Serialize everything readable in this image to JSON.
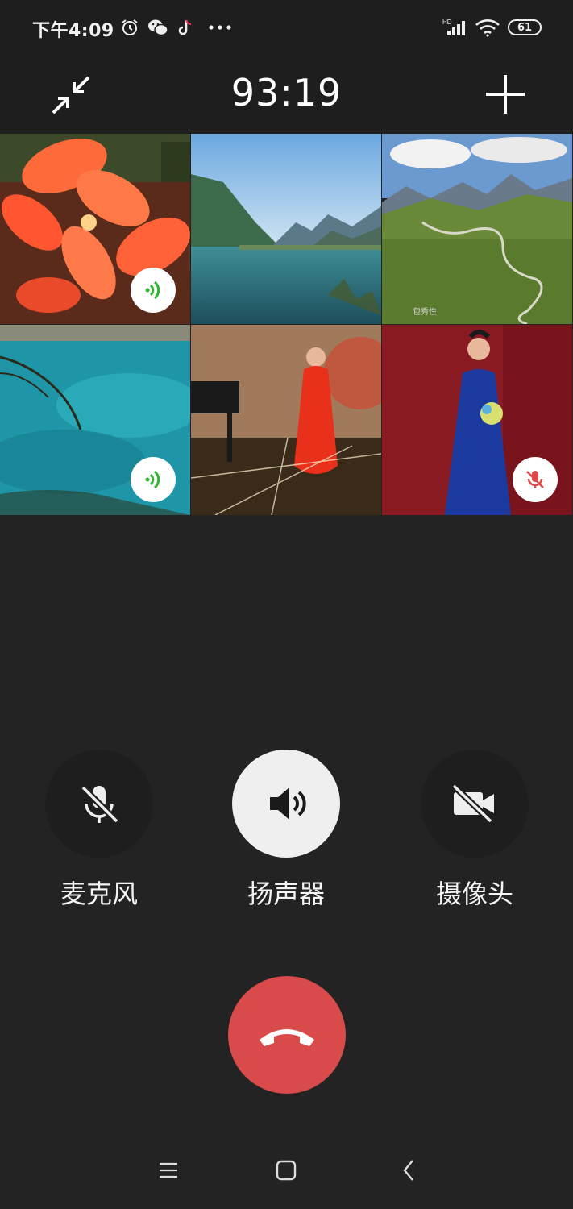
{
  "status_bar": {
    "time": "下午4:09",
    "battery": "61",
    "icons": [
      "alarm-icon",
      "wechat-icon",
      "tiktok-icon",
      "more-dots-icon",
      "hd-signal-icon",
      "wifi-icon",
      "battery-icon"
    ]
  },
  "call": {
    "timer": "93:19",
    "minimize_icon": "minimize-arrows-icon",
    "add_icon": "plus-icon"
  },
  "participants": [
    {
      "tile": "red-flowers",
      "audio": "speaking"
    },
    {
      "tile": "mountain-lake",
      "audio": "none"
    },
    {
      "tile": "green-valley",
      "audio": "none",
      "caption": "包秀性"
    },
    {
      "tile": "turquoise-lake",
      "audio": "speaking"
    },
    {
      "tile": "woman-red-dress",
      "audio": "none"
    },
    {
      "tile": "woman-blue-dress",
      "audio": "muted"
    }
  ],
  "controls": {
    "microphone": {
      "label": "麦克风",
      "state": "off"
    },
    "speaker": {
      "label": "扬声器",
      "state": "on"
    },
    "camera": {
      "label": "摄像头",
      "state": "off"
    }
  },
  "hangup_icon": "hang-up-phone-icon",
  "nav": [
    "menu-icon",
    "home-icon",
    "back-icon"
  ],
  "colors": {
    "background": "#232323",
    "hangup": "#d94a4a",
    "speaking": "#2db52d",
    "muted": "#e04848"
  }
}
